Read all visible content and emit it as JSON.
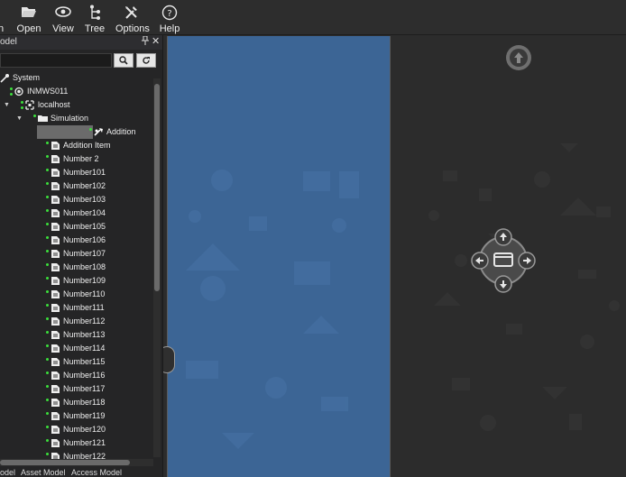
{
  "toolbar": {
    "items": [
      {
        "label": "n",
        "icon": "partial-icon"
      },
      {
        "label": "Open",
        "icon": "folder-open-icon"
      },
      {
        "label": "View",
        "icon": "eye-icon"
      },
      {
        "label": "Tree",
        "icon": "tree-icon"
      },
      {
        "label": "Options",
        "icon": "tools-icon"
      },
      {
        "label": "Help",
        "icon": "help-icon"
      }
    ]
  },
  "panel": {
    "title": "odel",
    "pin_glyph": "📌",
    "close_glyph": "✕",
    "search_value": "",
    "search_button": "🔍",
    "refresh_button": "⟳"
  },
  "tree": {
    "nodes": [
      {
        "label": "System"
      },
      {
        "label": "INMWS011"
      },
      {
        "label": "localhost"
      },
      {
        "label": "Simulation"
      },
      {
        "label": "Addition"
      },
      {
        "label": "Addition Item"
      },
      {
        "label": "Number 2"
      },
      {
        "label": "Number101"
      },
      {
        "label": "Number102"
      },
      {
        "label": "Number103"
      },
      {
        "label": "Number104"
      },
      {
        "label": "Number105"
      },
      {
        "label": "Number106"
      },
      {
        "label": "Number107"
      },
      {
        "label": "Number108"
      },
      {
        "label": "Number109"
      },
      {
        "label": "Number110"
      },
      {
        "label": "Number111"
      },
      {
        "label": "Number112"
      },
      {
        "label": "Number113"
      },
      {
        "label": "Number114"
      },
      {
        "label": "Number115"
      },
      {
        "label": "Number116"
      },
      {
        "label": "Number117"
      },
      {
        "label": "Number118"
      },
      {
        "label": "Number119"
      },
      {
        "label": "Number120"
      },
      {
        "label": "Number121"
      },
      {
        "label": "Number122"
      }
    ]
  },
  "bottom_tabs": [
    "odel",
    "Asset Model",
    "Access Model"
  ],
  "colors": {
    "page_blue": "#3c6595",
    "status_green": "#3be03b"
  }
}
